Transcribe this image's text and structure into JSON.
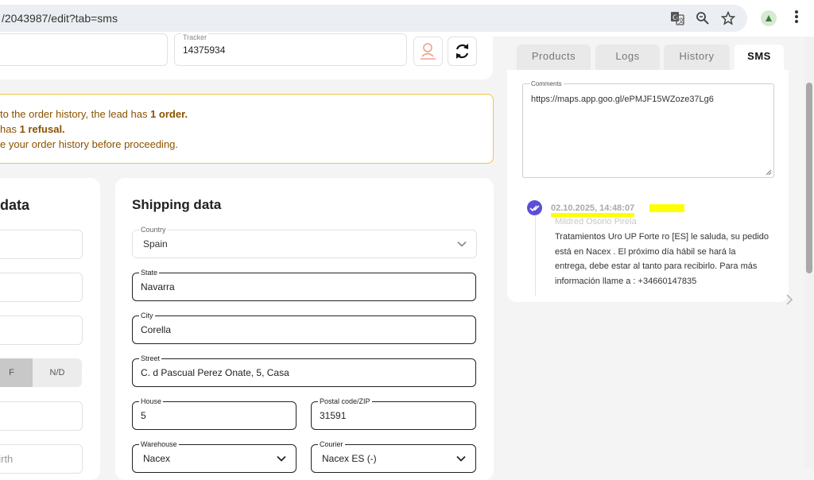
{
  "browser": {
    "url": "/2043987/edit?tab=sms",
    "translate_icon": "translate-icon",
    "zoom_icon": "zoom-icon",
    "star_icon": "star-icon",
    "extension_icon": "extension-icon",
    "menu_icon": "more-vert-icon"
  },
  "header": {
    "tracker_label": "Tracker",
    "tracker_value": "14375934",
    "map_pin_icon": "map-pin-icon",
    "refresh_icon": "refresh-icon"
  },
  "alert": {
    "line1_prefix": "to the order history, the lead has ",
    "line1_bold": "1 order.",
    "line2_prefix": "has ",
    "line2_bold": "1 refusal.",
    "line3": "e your order history before proceeding."
  },
  "left_card": {
    "title": "data",
    "gender_f": "F",
    "gender_nd": "N/D",
    "dob_placeholder": "birth"
  },
  "shipping": {
    "title": "Shipping data",
    "country_label": "Country",
    "country_value": "Spain",
    "state_label": "State",
    "state_value": "Navarra",
    "city_label": "City",
    "city_value": "Corella",
    "street_label": "Street",
    "street_value": "C. d Pascual Perez Onate, 5, Casa",
    "house_label": "House",
    "house_value": "5",
    "postal_label": "Postal code/ZIP",
    "postal_value": "31591",
    "warehouse_label": "Warehouse",
    "warehouse_value": "Nacex",
    "courier_label": "Courier",
    "courier_value": "Nacex ES (-)"
  },
  "tabs": [
    "Products",
    "Logs",
    "History",
    "SMS"
  ],
  "sms": {
    "comments_label": "Comments",
    "comments_value": "https://maps.app.goo.gl/ePMJF15WZoze37Lg6",
    "message": {
      "timestamp": "02.10.2025, 14:48:07",
      "author": "Mildred Osorio Pirela",
      "text": "Tratamientos Uro UP Forte ro [ES] le saluda, su pedido está en Nacex . El próximo día hábil se hará la entrega, debe estar al tanto para recibirlo. Para más información llame a : +34660147835",
      "status_icon": "double-check-icon"
    }
  },
  "colors": {
    "accent": "#5b4fd6",
    "alert_border": "#f2c53d",
    "alert_text": "#8a5200",
    "highlight": "#ffff00"
  }
}
